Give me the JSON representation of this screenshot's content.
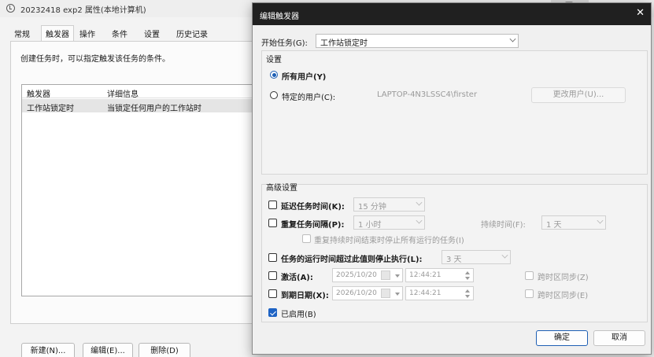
{
  "props_window": {
    "title": "20232418 exp2 属性(本地计算机)",
    "tabs": [
      "常规",
      "触发器",
      "操作",
      "条件",
      "设置",
      "历史记录"
    ],
    "description": "创建任务时，可以指定触发该任务的条件。",
    "columns": [
      "触发器",
      "详细信息"
    ],
    "rows": [
      {
        "trigger": "工作站锁定时",
        "details": "当锁定任何用户的工作站时"
      }
    ],
    "buttons": {
      "new": "新建(N)...",
      "edit": "编辑(E)...",
      "delete": "删除(D)"
    }
  },
  "dialog": {
    "title": "编辑触发器",
    "close_glyph": "✕",
    "begin_task_label": "开始任务(G):",
    "begin_task_value": "工作站锁定时",
    "settings_label": "设置",
    "any_user_label": "所有用户(Y)",
    "specific_user_label": "特定的用户(C):",
    "user_name": "LAPTOP-4N3LSSC4\\firster",
    "change_user_button": "更改用户(U)...",
    "advanced_label": "高级设置",
    "delay_label": "延迟任务时间(K):",
    "delay_value": "15 分钟",
    "repeat_label": "重复任务间隔(P):",
    "repeat_value": "1 小时",
    "duration_label": "持续时间(F):",
    "duration_value": "1 天",
    "stop_all_label": "重复持续时间结束时停止所有运行的任务(I)",
    "stop_if_label": "任务的运行时间超过此值则停止执行(L):",
    "stop_if_value": "3 天",
    "activate_label": "激活(A):",
    "activate_date": "2025/10/20",
    "activate_time": "12:44:21",
    "expire_label": "到期日期(X):",
    "expire_date": "2026/10/20",
    "expire_time": "12:44:21",
    "sync_tz_activate": "跨时区同步(Z)",
    "sync_tz_expire": "跨时区同步(E)",
    "enabled_label": "已启用(B)",
    "enabled": true,
    "ok_button": "确定",
    "cancel_button": "取消"
  },
  "colors": {
    "accent": "#1e5fb4",
    "dialog_title_bar": "#202020"
  }
}
